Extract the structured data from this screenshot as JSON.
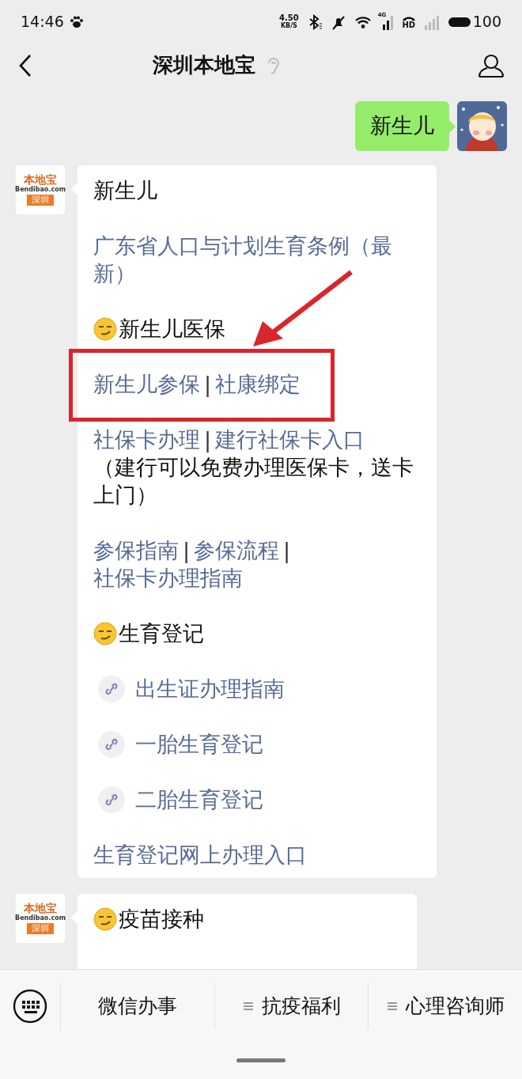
{
  "status_bar": {
    "time": "14:46",
    "speed": "4.50",
    "speed_unit": "KB/S",
    "network": "4G",
    "hd": "HD",
    "battery": "100"
  },
  "header": {
    "title": "深圳本地宝"
  },
  "sent": {
    "text": "新生儿"
  },
  "cards": [
    {
      "logo": {
        "brand": "本地宝",
        "site": "Bendibao.com",
        "city": "深圳"
      },
      "blocks": [
        {
          "kind": "title",
          "text": "新生儿"
        },
        {
          "kind": "link",
          "text": "广东省人口与计划生育条例（最新）"
        },
        {
          "kind": "section",
          "text": "新生儿医保"
        },
        {
          "kind": "links",
          "highlighted": true,
          "parts": [
            {
              "kind": "link",
              "text": "新生儿参保"
            },
            {
              "kind": "sep",
              "text": "|"
            },
            {
              "kind": "link",
              "text": "社康绑定"
            }
          ]
        },
        {
          "kind": "links",
          "highlighted": false,
          "parts": [
            {
              "kind": "link",
              "text": "社保卡办理"
            },
            {
              "kind": "sep",
              "text": "|"
            },
            {
              "kind": "link",
              "text": "建行社保卡入口"
            },
            {
              "kind": "note",
              "text": "（建行可以免费办理医保卡，送卡上门）"
            }
          ]
        },
        {
          "kind": "links",
          "highlighted": false,
          "parts": [
            {
              "kind": "link",
              "text": "参保指南"
            },
            {
              "kind": "sep",
              "text": "|"
            },
            {
              "kind": "link",
              "text": "参保流程"
            },
            {
              "kind": "sep",
              "text": "|"
            },
            {
              "kind": "link",
              "text": "社保卡办理指南"
            }
          ]
        },
        {
          "kind": "section",
          "text": "生育登记"
        },
        {
          "kind": "link_item",
          "text": "出生证办理指南"
        },
        {
          "kind": "link_item",
          "text": "一胎生育登记"
        },
        {
          "kind": "link_item",
          "text": "二胎生育登记"
        },
        {
          "kind": "link",
          "text": "生育登记网上办理入口"
        }
      ]
    },
    {
      "logo": {
        "brand": "本地宝",
        "site": "Bendibao.com",
        "city": "深圳"
      },
      "blocks": [
        {
          "kind": "section",
          "text": "疫苗接种"
        }
      ]
    }
  ],
  "menu": [
    {
      "text": "微信办事",
      "submenu": false
    },
    {
      "text": "抗疫福利",
      "submenu": true
    },
    {
      "text": "心理咨询师",
      "submenu": true
    }
  ]
}
